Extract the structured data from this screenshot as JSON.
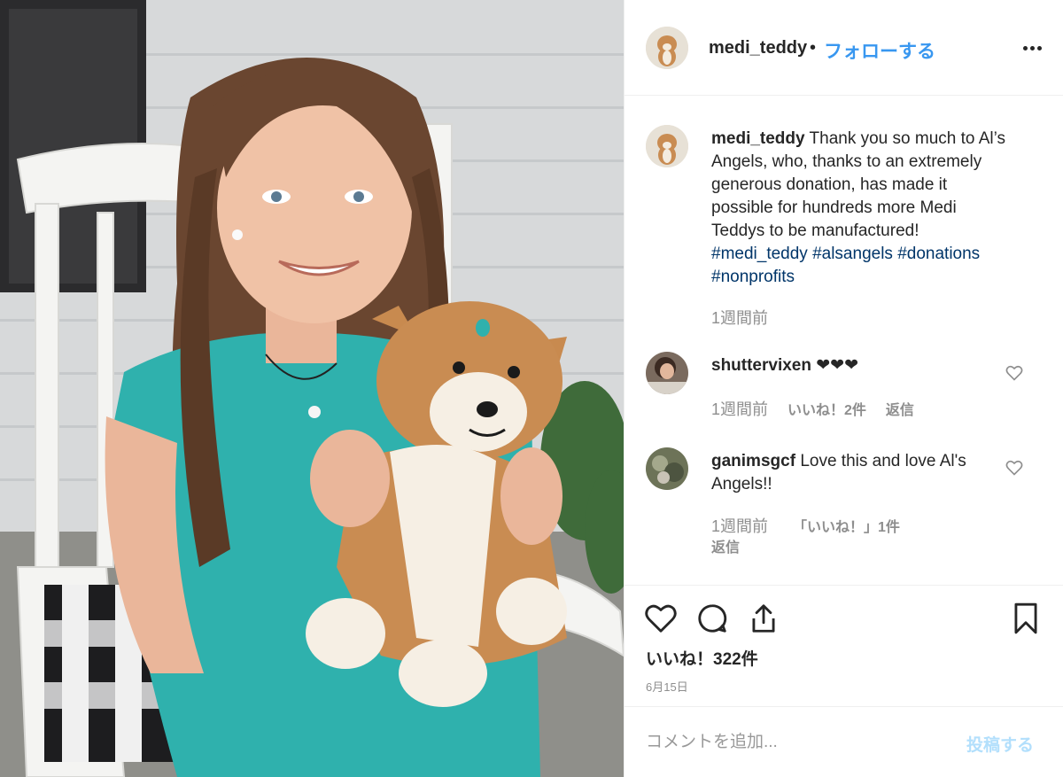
{
  "post": {
    "username": "medi_teddy",
    "separator": "•",
    "follow_label": "フォローする",
    "more_icon": "more-options-icon"
  },
  "caption": {
    "username": "medi_teddy",
    "text": "Thank you so much to Al’s Angels, who, thanks to an extremely generous donation, has made it possible for hundreds more Medi Teddys to be manufactured!",
    "hashtags": [
      "#medi_teddy",
      "#alsangels",
      "#donations",
      "#nonprofits"
    ],
    "time": "1週間前"
  },
  "comments": [
    {
      "username": "shuttervixen",
      "text": "❤❤❤",
      "time": "1週間前",
      "likes": "いいね！2件",
      "reply": "返信"
    },
    {
      "username": "ganimsgcf",
      "text": "Love this and love Al's Angels!!",
      "time": "1週間前",
      "likes": "「いいね！」1件",
      "reply": "返信"
    }
  ],
  "actions": {
    "icons": [
      "heart-icon",
      "comment-icon",
      "share-icon",
      "bookmark-icon"
    ],
    "likes_count": "いいね！322件",
    "date": "6月15日"
  },
  "add_comment": {
    "placeholder": "コメントを追加...",
    "post_label": "投稿する"
  },
  "colors": {
    "accent": "#3897f0",
    "hashtag": "#003569",
    "muted": "#8e8e8e",
    "post_disabled": "#b2dffc"
  }
}
